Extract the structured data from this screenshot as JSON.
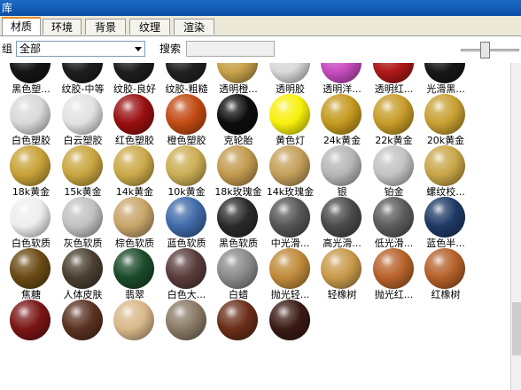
{
  "window": {
    "title": "库"
  },
  "tabs": [
    {
      "label": "材质",
      "active": true
    },
    {
      "label": "环境",
      "active": false
    },
    {
      "label": "背景",
      "active": false
    },
    {
      "label": "纹理",
      "active": false
    },
    {
      "label": "渲染",
      "active": false
    }
  ],
  "toolbar": {
    "group_label": "组",
    "group_value": "全部",
    "search_label": "搜索",
    "search_value": "",
    "zoom_slider_fraction": 0.4
  },
  "materials": [
    {
      "label": "黑色塑...",
      "color": "#151515"
    },
    {
      "label": "纹胶-中等",
      "color": "#1e1e1e"
    },
    {
      "label": "纹胶-良好",
      "color": "#1e1e1e"
    },
    {
      "label": "纹胶-粗糙",
      "color": "#222222"
    },
    {
      "label": "透明橙...",
      "color": "#c8a24a"
    },
    {
      "label": "透明胶",
      "color": "#d9d9d9"
    },
    {
      "label": "透明洋...",
      "color": "#c84cc0"
    },
    {
      "label": "透明红...",
      "color": "#b01818"
    },
    {
      "label": "光滑黑...",
      "color": "#181818"
    },
    {
      "label": "白色塑胶",
      "color": "#d9d9d9"
    },
    {
      "label": "白云塑胶",
      "color": "#e2e2e2"
    },
    {
      "label": "红色塑胶",
      "color": "#9a0f0f"
    },
    {
      "label": "橙色塑胶",
      "color": "#c24a12"
    },
    {
      "label": "克轮胎",
      "color": "#0d0d0d"
    },
    {
      "label": "黄色灯",
      "color": "#f7f00c"
    },
    {
      "label": "24k黄金",
      "color": "#c59a1f"
    },
    {
      "label": "22k黄金",
      "color": "#c79c28"
    },
    {
      "label": "20k黄金",
      "color": "#c8a032"
    },
    {
      "label": "18k黄金",
      "color": "#c8a238"
    },
    {
      "label": "15k黄金",
      "color": "#c9a640"
    },
    {
      "label": "14k黄金",
      "color": "#cbaa4a"
    },
    {
      "label": "10k黄金",
      "color": "#ccae55"
    },
    {
      "label": "18k玫瑰金",
      "color": "#c29a4e"
    },
    {
      "label": "14k玫瑰金",
      "color": "#c4a05a"
    },
    {
      "label": "银",
      "color": "#b7b7b7"
    },
    {
      "label": "铂金",
      "color": "#c4c4c4"
    },
    {
      "label": "螺纹校...",
      "color": "#c9a648"
    },
    {
      "label": "白色软质",
      "color": "#eeeeee"
    },
    {
      "label": "灰色软质",
      "color": "#c2c2c2"
    },
    {
      "label": "棕色软质",
      "color": "#c8a56a"
    },
    {
      "label": "蓝色软质",
      "color": "#3f6aa8"
    },
    {
      "label": "黑色软质",
      "color": "#2a2a2a"
    },
    {
      "label": "中光滑...",
      "color": "#555555"
    },
    {
      "label": "高光滑...",
      "color": "#4a4a4a"
    },
    {
      "label": "低光滑...",
      "color": "#5c5c5c"
    },
    {
      "label": "蓝色半...",
      "color": "#1f3a66"
    },
    {
      "label": "焦糖",
      "color": "#6a4a14"
    },
    {
      "label": "人体皮肤",
      "color": "#4a3f30"
    },
    {
      "label": "翡翠",
      "color": "#1b4a2a"
    },
    {
      "label": "白色大...",
      "color": "#5a3c3c"
    },
    {
      "label": "白蜡",
      "color": "#8a8a8a"
    },
    {
      "label": "抛光轻...",
      "color": "#c08a3a"
    },
    {
      "label": "轻橡树",
      "color": "#c89a4a"
    },
    {
      "label": "抛光红...",
      "color": "#b8622a"
    },
    {
      "label": "红橡树",
      "color": "#b5602a"
    },
    {
      "label": "",
      "color": "#7a1515"
    },
    {
      "label": "",
      "color": "#5a3222"
    },
    {
      "label": "",
      "color": "#d8b88a"
    },
    {
      "label": "",
      "color": "#8a7a66"
    },
    {
      "label": "",
      "color": "#6a2e18"
    },
    {
      "label": "",
      "color": "#3a1a14"
    }
  ]
}
